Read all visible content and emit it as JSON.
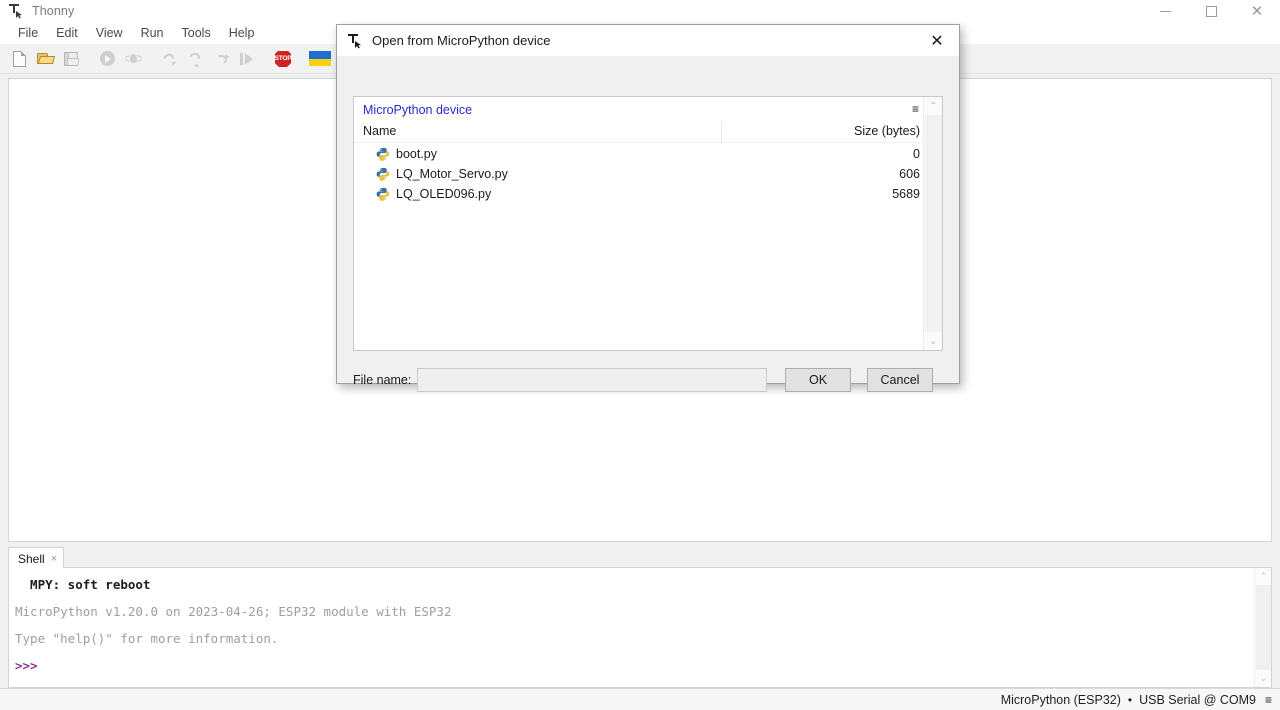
{
  "window": {
    "title": "Thonny",
    "icon": "thonny-icon",
    "controls": {
      "minimize": "minimize-icon",
      "maximize": "maximize-icon",
      "close": "close-icon"
    }
  },
  "menubar": {
    "items": [
      {
        "label": "File"
      },
      {
        "label": "Edit"
      },
      {
        "label": "View"
      },
      {
        "label": "Run"
      },
      {
        "label": "Tools"
      },
      {
        "label": "Help"
      }
    ]
  },
  "toolbar": {
    "buttons": [
      {
        "name": "new-file",
        "icon": "new-file-icon"
      },
      {
        "name": "open-file",
        "icon": "open-folder-icon"
      },
      {
        "name": "save-file",
        "icon": "save-disk-icon"
      },
      {
        "name": "run-script",
        "icon": "run-play-icon"
      },
      {
        "name": "debug-script",
        "icon": "debug-bug-icon"
      },
      {
        "name": "step-over",
        "icon": "step-over-icon"
      },
      {
        "name": "step-into",
        "icon": "step-into-icon"
      },
      {
        "name": "step-out",
        "icon": "step-out-icon"
      },
      {
        "name": "resume",
        "icon": "resume-icon"
      },
      {
        "name": "stop",
        "icon": "stop-icon"
      },
      {
        "name": "support-ukraine",
        "icon": "ukraine-flag-icon"
      }
    ],
    "stop_label": "STOP"
  },
  "shell": {
    "tab_label": "Shell",
    "tab_close": "×",
    "lines": [
      {
        "text": "  MPY: soft reboot",
        "style": "reboot"
      },
      {
        "text": "MicroPython v1.20.0 on 2023-04-26; ESP32 module with ESP32",
        "style": "info"
      },
      {
        "text": "Type \"help()\" for more information.",
        "style": "info"
      },
      {
        "text": ">>>",
        "style": "prompt"
      }
    ]
  },
  "statusbar": {
    "interpreter": "MicroPython (ESP32)",
    "separator": "•",
    "port": "USB Serial @ COM9",
    "menu_icon": "hamburger-icon"
  },
  "dialog": {
    "title": "Open from MicroPython device",
    "icon": "thonny-icon",
    "close": "✕",
    "device_label": "MicroPython device",
    "list_menu_icon": "hamburger-icon",
    "columns": {
      "name": "Name",
      "size": "Size (bytes)"
    },
    "files": [
      {
        "name": "boot.py",
        "size": "0",
        "icon": "python-file-icon"
      },
      {
        "name": "LQ_Motor_Servo.py",
        "size": "606",
        "icon": "python-file-icon"
      },
      {
        "name": "LQ_OLED096.py",
        "size": "5689",
        "icon": "python-file-icon"
      }
    ],
    "filename_label": "File name:",
    "filename_value": "",
    "filename_placeholder": "",
    "ok_label": "OK",
    "cancel_label": "Cancel",
    "scrollbar": {
      "up": "⌃",
      "down": "⌄"
    }
  },
  "colors": {
    "device_link": "#2a2ad0",
    "prompt": "#8e2f8e",
    "shell_info": "#9e9e9e",
    "stop_red": "#cf2222",
    "flag_blue": "#1f6fd0",
    "flag_yellow": "#f5d117"
  }
}
